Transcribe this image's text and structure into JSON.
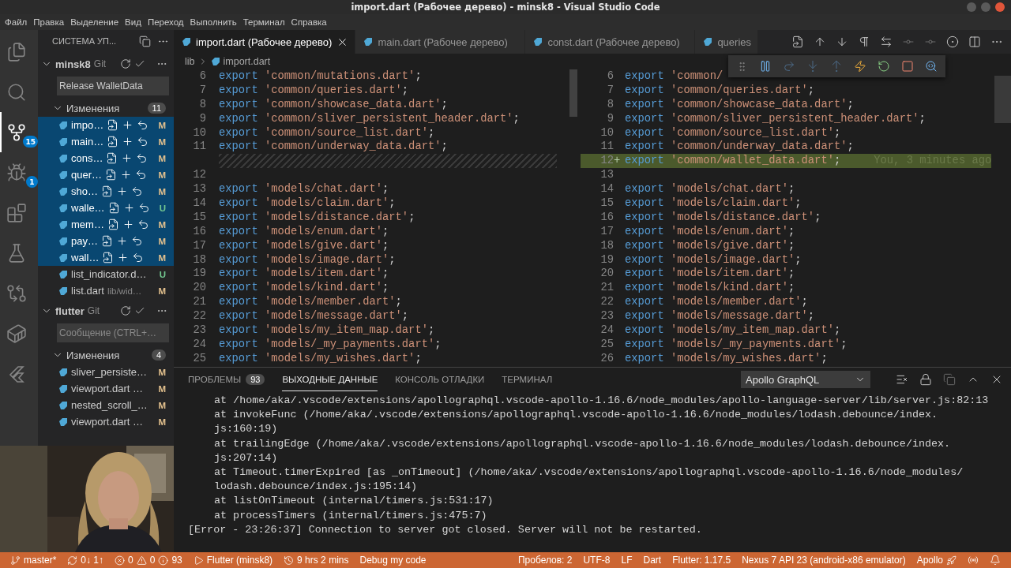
{
  "window": {
    "title": "import.dart (Рабочее дерево) - minsk8 - Visual Studio Code"
  },
  "menu": [
    "Файл",
    "Правка",
    "Выделение",
    "Вид",
    "Переход",
    "Выполнить",
    "Терминал",
    "Справка"
  ],
  "activity_bar": [
    {
      "kind": "explorer",
      "selected": false
    },
    {
      "kind": "search",
      "selected": false
    },
    {
      "kind": "scm",
      "selected": true,
      "badge": "15"
    },
    {
      "kind": "debug",
      "selected": false,
      "badge": "1"
    },
    {
      "kind": "extensions",
      "selected": false
    },
    {
      "kind": "testing",
      "selected": false
    },
    {
      "kind": "git-graph",
      "selected": false
    },
    {
      "kind": "docker",
      "selected": false
    },
    {
      "kind": "flutter",
      "selected": false
    }
  ],
  "sidebar": {
    "title": "СИСТЕМА УП...",
    "repositories": [
      {
        "name": "minsk8",
        "type": "Git",
        "message": {
          "value": "Release WalletData"
        },
        "group": {
          "label": "Изменения",
          "count": "11",
          "files": [
            {
              "name": "impo…",
              "status": "M",
              "color": "#e2c08d",
              "selected": true
            },
            {
              "name": "main…",
              "status": "M",
              "color": "#e2c08d",
              "selected": true
            },
            {
              "name": "cons…",
              "status": "M",
              "color": "#e2c08d",
              "selected": true
            },
            {
              "name": "quer…",
              "status": "M",
              "color": "#e2c08d",
              "selected": true
            },
            {
              "name": "sho…",
              "status": "M",
              "color": "#e2c08d",
              "selected": true
            },
            {
              "name": "walle…",
              "status": "U",
              "color": "#73c991",
              "selected": true
            },
            {
              "name": "mem…",
              "status": "M",
              "color": "#e2c08d",
              "selected": true
            },
            {
              "name": "pay…",
              "status": "M",
              "color": "#e2c08d",
              "selected": true
            },
            {
              "name": "wall…",
              "status": "M",
              "color": "#e2c08d",
              "selected": true
            },
            {
              "name": "list_indicator.d…",
              "status": "U",
              "color": "#73c991",
              "selected": false
            },
            {
              "name": "list.dart",
              "description": "lib/wid…",
              "status": "M",
              "color": "#e2c08d",
              "selected": false
            }
          ]
        }
      },
      {
        "name": "flutter",
        "type": "Git",
        "message": {
          "placeholder": "Сообщение (CTRL+…"
        },
        "group": {
          "label": "Изменения",
          "count": "4",
          "files": [
            {
              "name": "sliver_persiste…",
              "status": "M",
              "color": "#e2c08d",
              "selected": false
            },
            {
              "name": "viewport.dart …",
              "status": "M",
              "color": "#e2c08d",
              "selected": false
            },
            {
              "name": "nested_scroll_…",
              "status": "M",
              "color": "#e2c08d",
              "selected": false
            },
            {
              "name": "viewport.dart …",
              "status": "M",
              "color": "#e2c08d",
              "selected": false
            }
          ]
        }
      }
    ]
  },
  "webcam": {
    "kind": "picture"
  },
  "editor": {
    "tabs": [
      {
        "label": "import.dart (Рабочее дерево)",
        "selected": true
      },
      {
        "label": "main.dart (Рабочее дерево)",
        "selected": false
      },
      {
        "label": "const.dart (Рабочее дерево)",
        "selected": false
      },
      {
        "label": "queries",
        "selected": false
      }
    ],
    "breadcrumb": [
      "lib",
      "import.dart"
    ],
    "left_lines": [
      {
        "kind": "code",
        "number": "6",
        "keyword": "export",
        "text": "'common/mutations.dart'",
        "end": ";"
      },
      {
        "kind": "code",
        "number": "7",
        "keyword": "export",
        "text": "'common/queries.dart'",
        "end": ";"
      },
      {
        "kind": "code",
        "number": "8",
        "keyword": "export",
        "text": "'common/showcase_data.dart'",
        "end": ";"
      },
      {
        "kind": "code",
        "number": "9",
        "keyword": "export",
        "text": "'common/sliver_persistent_header.dart'",
        "end": ";"
      },
      {
        "kind": "code",
        "number": "10",
        "keyword": "export",
        "text": "'common/source_list.dart'",
        "end": ";"
      },
      {
        "kind": "code",
        "number": "11",
        "keyword": "export",
        "text": "'common/underway_data.dart'",
        "end": ";"
      },
      {
        "kind": "filler"
      },
      {
        "kind": "blank",
        "number": "12"
      },
      {
        "kind": "code",
        "number": "13",
        "keyword": "export",
        "text": "'models/chat.dart'",
        "end": ";"
      },
      {
        "kind": "code",
        "number": "14",
        "keyword": "export",
        "text": "'models/claim.dart'",
        "end": ";"
      },
      {
        "kind": "code",
        "number": "15",
        "keyword": "export",
        "text": "'models/distance.dart'",
        "end": ";"
      },
      {
        "kind": "code",
        "number": "16",
        "keyword": "export",
        "text": "'models/enum.dart'",
        "end": ";"
      },
      {
        "kind": "code",
        "number": "17",
        "keyword": "export",
        "text": "'models/give.dart'",
        "end": ";"
      },
      {
        "kind": "code",
        "number": "18",
        "keyword": "export",
        "text": "'models/image.dart'",
        "end": ";"
      },
      {
        "kind": "code",
        "number": "19",
        "keyword": "export",
        "text": "'models/item.dart'",
        "end": ";"
      },
      {
        "kind": "code",
        "number": "20",
        "keyword": "export",
        "text": "'models/kind.dart'",
        "end": ";"
      },
      {
        "kind": "code",
        "number": "21",
        "keyword": "export",
        "text": "'models/member.dart'",
        "end": ";"
      },
      {
        "kind": "code",
        "number": "22",
        "keyword": "export",
        "text": "'models/message.dart'",
        "end": ";"
      },
      {
        "kind": "code",
        "number": "23",
        "keyword": "export",
        "text": "'models/my_item_map.dart'",
        "end": ";"
      },
      {
        "kind": "code",
        "number": "24",
        "keyword": "export",
        "text": "'models/_my_payments.dart'",
        "end": ";"
      },
      {
        "kind": "code",
        "number": "25",
        "keyword": "export",
        "text": "'models/my_wishes.dart'",
        "end": ";"
      }
    ],
    "right_lines": [
      {
        "kind": "code",
        "added": false,
        "number": "6",
        "keyword": "export",
        "text": "'common/"
      },
      {
        "kind": "code",
        "added": false,
        "number": "7",
        "keyword": "export",
        "text": "'common/queries.dart'",
        "end": ";"
      },
      {
        "kind": "code",
        "added": false,
        "number": "8",
        "keyword": "export",
        "text": "'common/showcase_data.dart'",
        "end": ";"
      },
      {
        "kind": "code",
        "added": false,
        "number": "9",
        "keyword": "export",
        "text": "'common/sliver_persistent_header.dart'",
        "end": ";"
      },
      {
        "kind": "code",
        "added": false,
        "number": "10",
        "keyword": "export",
        "text": "'common/source_list.dart'",
        "end": ";"
      },
      {
        "kind": "code",
        "added": false,
        "number": "11",
        "keyword": "export",
        "text": "'common/underway_data.dart'",
        "end": ";"
      },
      {
        "kind": "code",
        "added": true,
        "number": "12",
        "marker": "+",
        "keyword": "export",
        "text": "'common/wallet_data.dart'",
        "end": ";",
        "annotation": "You, 3 minutes ago"
      },
      {
        "kind": "blank",
        "added": false,
        "number": "13"
      },
      {
        "kind": "code",
        "added": false,
        "number": "14",
        "keyword": "export",
        "text": "'models/chat.dart'",
        "end": ";"
      },
      {
        "kind": "code",
        "added": false,
        "number": "15",
        "keyword": "export",
        "text": "'models/claim.dart'",
        "end": ";"
      },
      {
        "kind": "code",
        "added": false,
        "number": "16",
        "keyword": "export",
        "text": "'models/distance.dart'",
        "end": ";"
      },
      {
        "kind": "code",
        "added": false,
        "number": "17",
        "keyword": "export",
        "text": "'models/enum.dart'",
        "end": ";"
      },
      {
        "kind": "code",
        "added": false,
        "number": "18",
        "keyword": "export",
        "text": "'models/give.dart'",
        "end": ";"
      },
      {
        "kind": "code",
        "added": false,
        "number": "19",
        "keyword": "export",
        "text": "'models/image.dart'",
        "end": ";"
      },
      {
        "kind": "code",
        "added": false,
        "number": "20",
        "keyword": "export",
        "text": "'models/item.dart'",
        "end": ";"
      },
      {
        "kind": "code",
        "added": false,
        "number": "21",
        "keyword": "export",
        "text": "'models/kind.dart'",
        "end": ";"
      },
      {
        "kind": "code",
        "added": false,
        "number": "22",
        "keyword": "export",
        "text": "'models/member.dart'",
        "end": ";"
      },
      {
        "kind": "code",
        "added": false,
        "number": "23",
        "keyword": "export",
        "text": "'models/message.dart'",
        "end": ";"
      },
      {
        "kind": "code",
        "added": false,
        "number": "24",
        "keyword": "export",
        "text": "'models/my_item_map.dart'",
        "end": ";"
      },
      {
        "kind": "code",
        "added": false,
        "number": "25",
        "keyword": "export",
        "text": "'models/_my_payments.dart'",
        "end": ";"
      },
      {
        "kind": "code",
        "added": false,
        "number": "26",
        "keyword": "export",
        "text": "'models/my_wishes.dart'",
        "end": ";"
      }
    ]
  },
  "panel": {
    "tabs": [
      {
        "label": "ПРОБЛЕМЫ",
        "badge": "93",
        "selected": false
      },
      {
        "label": "ВЫХОДНЫЕ ДАННЫЕ",
        "selected": true
      },
      {
        "label": "КОНСОЛЬ ОТЛАДКИ",
        "selected": false
      },
      {
        "label": "ТЕРМИНАЛ",
        "selected": false
      }
    ],
    "channel": "Apollo GraphQL",
    "output": [
      {
        "indented": true,
        "text": "at /home/aka/.vscode/extensions/apollographql.vscode-apollo-1.16.6/node_modules/apollo-language-server/lib/server.js:82:13"
      },
      {
        "indented": true,
        "text": "at invokeFunc (/home/aka/.vscode/extensions/apollographql.vscode-apollo-1.16.6/node_modules/lodash.debounce/index."
      },
      {
        "indented": true,
        "text": "js:160:19)"
      },
      {
        "indented": true,
        "text": "at trailingEdge (/home/aka/.vscode/extensions/apollographql.vscode-apollo-1.16.6/node_modules/lodash.debounce/index."
      },
      {
        "indented": true,
        "text": "js:207:14)"
      },
      {
        "indented": true,
        "text": "at Timeout.timerExpired [as _onTimeout] (/home/aka/.vscode/extensions/apollographql.vscode-apollo-1.16.6/node_modules/"
      },
      {
        "indented": true,
        "text": "lodash.debounce/index.js:195:14)"
      },
      {
        "indented": true,
        "text": "at listOnTimeout (internal/timers.js:531:17)"
      },
      {
        "indented": true,
        "text": "at processTimers (internal/timers.js:475:7)"
      },
      {
        "indented": false,
        "text": "[Error - 23:26:37] Connection to server got closed. Server will not be restarted."
      }
    ]
  },
  "status_bar": {
    "left": [
      {
        "kind": "branch",
        "text": "master*"
      },
      {
        "kind": "sync",
        "text": "0↓ 1↑"
      },
      {
        "kind": "problems",
        "errors": "0",
        "warnings": "0",
        "infos": "93"
      },
      {
        "kind": "run",
        "text": "Flutter (minsk8)"
      },
      {
        "kind": "time",
        "text": "9 hrs 2 mins"
      },
      {
        "kind": "plain",
        "text": "Debug my code"
      }
    ],
    "right": [
      {
        "kind": "plain",
        "text": "Пробелов: 2"
      },
      {
        "kind": "plain",
        "text": "UTF-8"
      },
      {
        "kind": "plain",
        "text": "LF"
      },
      {
        "kind": "plain",
        "text": "Dart"
      },
      {
        "kind": "plain",
        "text": "Flutter: 1.17.5"
      },
      {
        "kind": "plain",
        "text": "Nexus 7 API 23 (android-x86 emulator)"
      },
      {
        "kind": "apollo",
        "text": "Apollo"
      },
      {
        "kind": "broadcast"
      },
      {
        "kind": "bell"
      }
    ]
  }
}
